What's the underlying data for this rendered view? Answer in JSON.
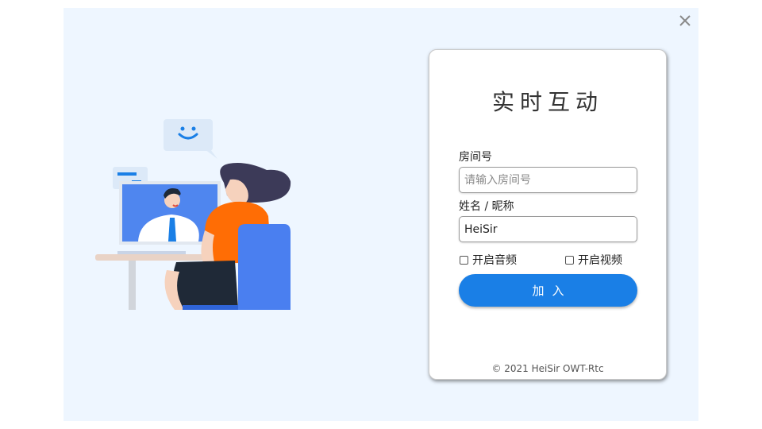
{
  "window": {
    "close_icon": "close-icon"
  },
  "login": {
    "title": "实时互动",
    "room_label": "房间号",
    "room_placeholder": "请输入房间号",
    "room_value": "",
    "name_label": "姓名 / 昵称",
    "name_value": "HeiSir",
    "audio_label": "开启音频",
    "audio_checked": false,
    "video_label": "开启视频",
    "video_checked": false,
    "join_label": "加入",
    "footer": "© 2021 HeiSir OWT-Rtc"
  },
  "colors": {
    "background": "#eef6ff",
    "accent": "#1a7fe6",
    "illustration_orange": "#ff6d05",
    "illustration_blue": "#3f7ff0"
  }
}
